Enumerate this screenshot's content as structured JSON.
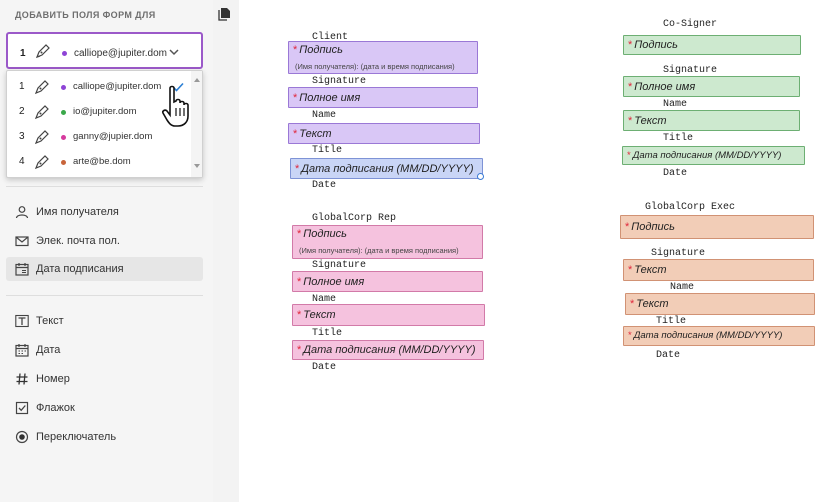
{
  "sidebar": {
    "header": "ДОБАВИТЬ ПОЛЯ ФОРМ ДЛЯ",
    "selected": {
      "num": "1",
      "email": "calliope@jupiter.dom",
      "color": "#8e44d6"
    },
    "recipients": [
      {
        "num": "1",
        "email": "calliope@jupiter.dom",
        "color": "#8e44d6"
      },
      {
        "num": "2",
        "email": "io@jupiter.dom",
        "color": "#3aa84a"
      },
      {
        "num": "3",
        "email": "ganny@jupier.dom",
        "color": "#d63a9e"
      },
      {
        "num": "4",
        "email": "arte@be.dom",
        "color": "#c8643a"
      }
    ],
    "section1": [
      "Имя получателя",
      "Элек. почта пол.",
      "Дата подписания"
    ],
    "section2": [
      "Текст",
      "Дата",
      "Номер",
      "Флажок",
      "Переключатель"
    ]
  },
  "doc": {
    "client": {
      "heading": "Client",
      "sig": "Подпись",
      "sig_sub": "(Имя получателя): (дата и время подписания)",
      "sig_label": "Signature",
      "name_field": "Полное имя",
      "name_label": "Name",
      "title_field": "Текст",
      "title_label": "Title",
      "date_field": "Дата подписания (MM/DD/YYYY)",
      "date_label": "Date"
    },
    "cosigner": {
      "heading": "Co-Signer",
      "sig": "Подпись",
      "sig_label": "Signature",
      "name_field": "Полное имя",
      "name_label": "Name",
      "title_field": "Текст",
      "title_label": "Title",
      "date_field": "Дата подписания (MM/DD/YYYY)",
      "date_label": "Date"
    },
    "gcrep": {
      "heading": "GlobalCorp Rep",
      "sig": "Подпись",
      "sig_sub": "(Имя получателя): (дата и время подписания)",
      "sig_label": "Signature",
      "name_field": "Полное имя",
      "name_label": "Name",
      "title_field": "Текст",
      "title_label": "Title",
      "date_field": "Дата подписания (MM/DD/YYYY)",
      "date_label": "Date"
    },
    "gcexec": {
      "heading": "GlobalCorp Exec",
      "sig": "Подпись",
      "sig_label": "Signature",
      "name_field": "Текст",
      "name_label": "Name",
      "title_field": "Текст",
      "title_label": "Title",
      "date_field": "Дата подписания (MM/DD/YYYY)",
      "date_label": "Date"
    }
  }
}
